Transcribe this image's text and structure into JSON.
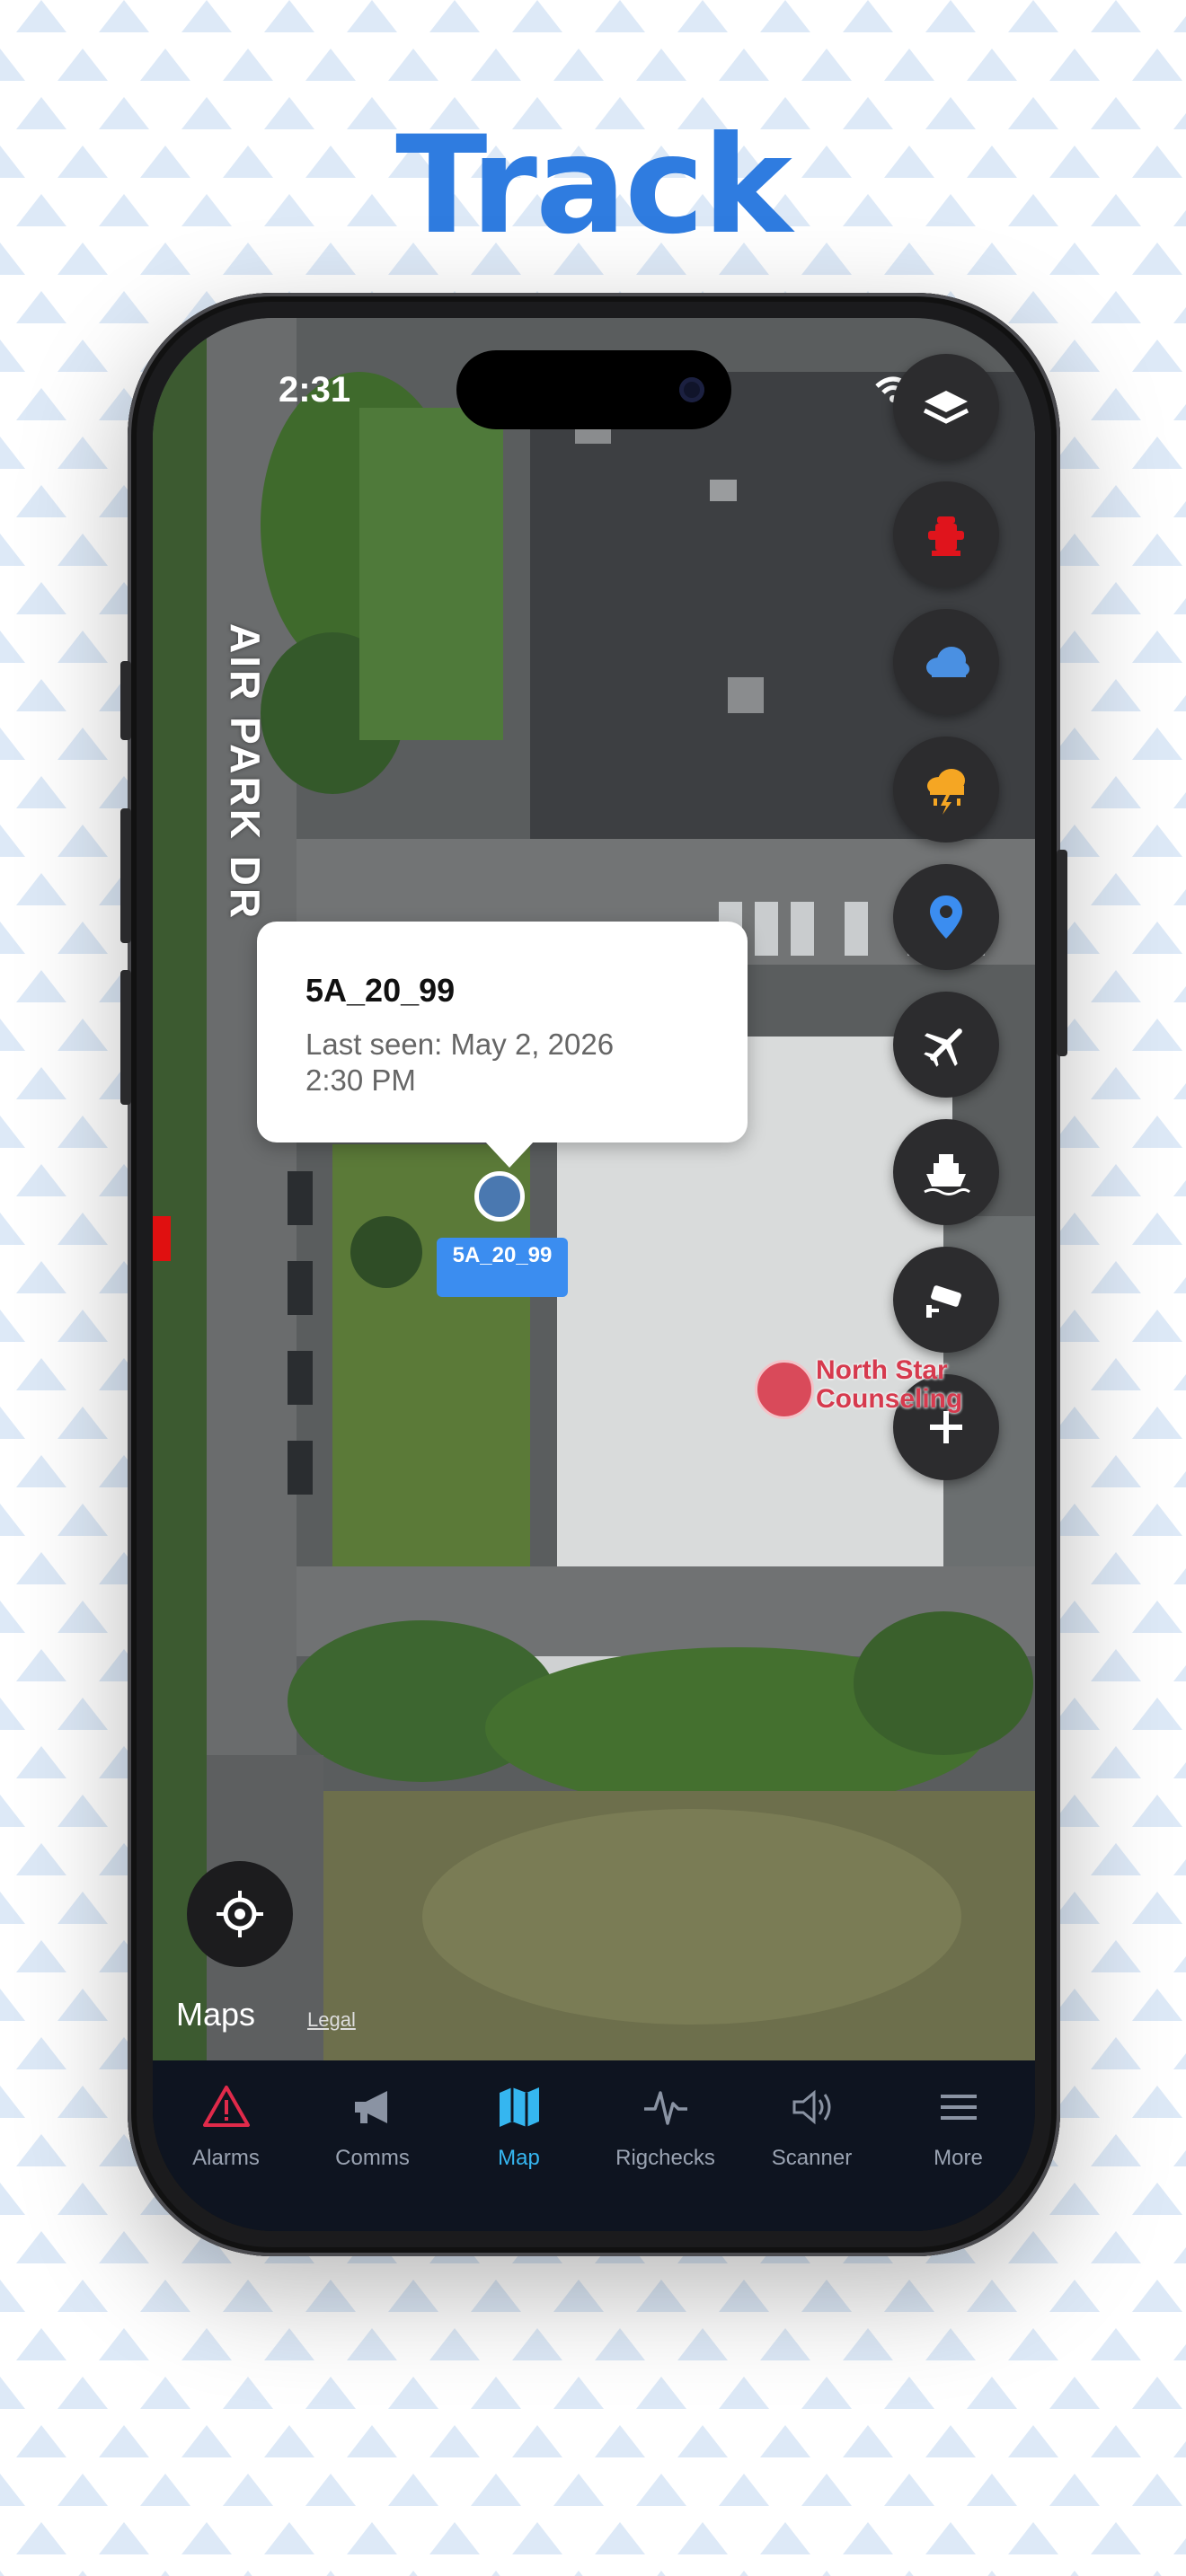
{
  "headline": "Track",
  "status": {
    "time": "2:31"
  },
  "map": {
    "street_label": "AIR PARK DR",
    "poi_label_line1": "North Star",
    "poi_label_line2": "Counseling",
    "attribution": "Maps",
    "legal": "Legal"
  },
  "popup": {
    "title": "5A_20_99",
    "line1": "Last seen: May 2, 2026",
    "line2": "2:30 PM"
  },
  "marker": {
    "label": "5A_20_99"
  },
  "fab_buttons": [
    {
      "name": "layers-icon",
      "color": "#ffffff"
    },
    {
      "name": "hydrant-icon",
      "color": "#e0141c"
    },
    {
      "name": "cloud-icon",
      "color": "#4a90e2"
    },
    {
      "name": "storm-icon",
      "color": "#f5a623"
    },
    {
      "name": "pin-icon",
      "color": "#3b8df0"
    },
    {
      "name": "airplane-icon",
      "color": "#ffffff"
    },
    {
      "name": "ship-icon",
      "color": "#ffffff"
    },
    {
      "name": "camera-icon",
      "color": "#ffffff"
    },
    {
      "name": "plus-icon",
      "color": "#ffffff"
    }
  ],
  "tabs": [
    {
      "label": "Alarms",
      "icon": "alarm-icon"
    },
    {
      "label": "Comms",
      "icon": "megaphone-icon"
    },
    {
      "label": "Map",
      "icon": "map-icon",
      "active": true
    },
    {
      "label": "Rigchecks",
      "icon": "pulse-icon"
    },
    {
      "label": "Scanner",
      "icon": "speaker-icon"
    },
    {
      "label": "More",
      "icon": "menu-icon"
    }
  ],
  "colors": {
    "accent": "#2f7ce0",
    "active_tab": "#35b6f0",
    "alarm_red": "#e02a4a"
  }
}
